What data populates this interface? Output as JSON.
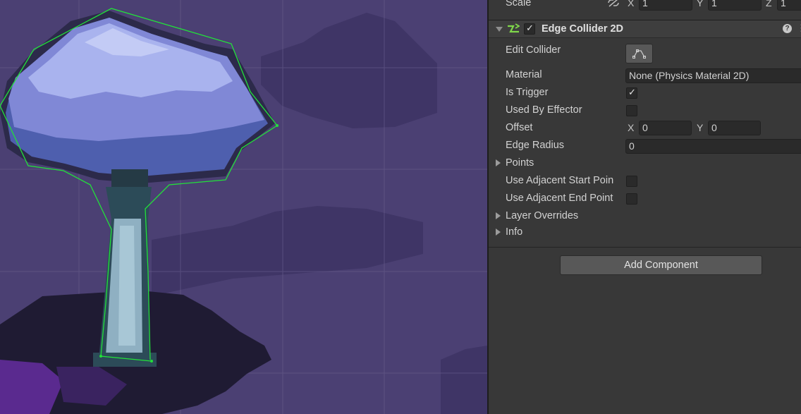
{
  "inspector": {
    "transform_scale": {
      "label": "Scale",
      "x_axis": "X",
      "x_value": "1",
      "y_axis": "Y",
      "y_value": "1",
      "z_axis": "Z",
      "z_value": "1"
    },
    "component": {
      "title": "Edge Collider 2D",
      "enabled": true,
      "help_icon": "?",
      "edit_collider_label": "Edit Collider",
      "material_label": "Material",
      "material_value": "None (Physics Material 2D)",
      "is_trigger_label": "Is Trigger",
      "is_trigger": true,
      "used_by_effector_label": "Used By Effector",
      "used_by_effector": false,
      "offset_label": "Offset",
      "offset_x_axis": "X",
      "offset_x": "0",
      "offset_y_axis": "Y",
      "offset_y": "0",
      "edge_radius_label": "Edge Radius",
      "edge_radius": "0",
      "points_label": "Points",
      "use_adjacent_start_label": "Use Adjacent Start Poin",
      "use_adjacent_start": false,
      "use_adjacent_end_label": "Use Adjacent End Point",
      "use_adjacent_end": false,
      "layer_overrides_label": "Layer Overrides",
      "info_label": "Info"
    },
    "add_component_label": "Add Component"
  },
  "colors": {
    "scene_bg": "#4a3f72",
    "collider_line": "#22e03a",
    "canopy_light": "#a9b3ee",
    "canopy_mid": "#8088d6",
    "canopy_dark": "#4e5fae",
    "trunk": "#8fb0c2",
    "inspector_bg": "#383838",
    "edge_collider_icon": "#7fd84a"
  }
}
